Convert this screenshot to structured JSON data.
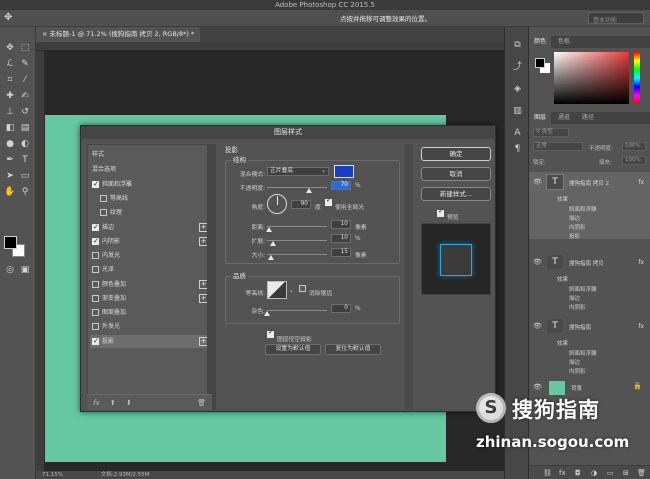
{
  "app": {
    "title": "Adobe Photoshop CC 2015.5"
  },
  "options_bar": {
    "hint": "点按并拖移可调整效果的位置。",
    "workspace": "基本功能",
    "move_icon": "move-icon"
  },
  "document": {
    "tab_label": "未标题-1 @ 71.2% (搜狗指南 拷贝 2, RGB/8*) *",
    "canvas_color": "#65c8a3"
  },
  "status_bar": {
    "zoom": "71.15%",
    "doc_info": "文档:2.93M/2.55M"
  },
  "toolbar": {
    "icons": [
      "move-icon",
      "marquee-icon",
      "lasso-icon",
      "quick-select-icon",
      "crop-icon",
      "eyedropper-icon",
      "heal-icon",
      "brush-icon",
      "stamp-icon",
      "history-brush-icon",
      "eraser-icon",
      "gradient-icon",
      "blur-icon",
      "dodge-icon",
      "pen-icon",
      "type-icon",
      "path-select-icon",
      "rectangle-icon",
      "hand-icon",
      "zoom-icon"
    ]
  },
  "right_panel": {
    "color_tabs": [
      "颜色",
      "色板"
    ],
    "layer_tabs": [
      "图层",
      "通道",
      "路径"
    ],
    "filter_label": "类型",
    "blend_mode": "正常",
    "opacity_label": "不透明度:",
    "opacity_value": "100%",
    "lock_label": "锁定:",
    "fill_label": "填充:",
    "fill_value": "100%",
    "layers": [
      {
        "name": "搜狗指南 拷贝 2",
        "effects_label": "效果",
        "effects": [
          "斜面和浮雕",
          "描边",
          "内阴影",
          "投影"
        ]
      },
      {
        "name": "搜狗指南 拷贝",
        "effects_label": "效果",
        "effects": [
          "斜面和浮雕",
          "描边",
          "内阴影"
        ]
      },
      {
        "name": "搜狗指南",
        "effects_label": "效果",
        "effects": [
          "斜面和浮雕",
          "描边",
          "内阴影"
        ]
      },
      {
        "name": "背景",
        "color": "#65c8a3"
      }
    ]
  },
  "dialog": {
    "title": "图层样式",
    "styles_header": "样式",
    "blend_options": "混合选项",
    "styles": [
      {
        "label": "斜面和浮雕",
        "checked": true,
        "plus": false
      },
      {
        "label": "等高线",
        "checked": false,
        "plus": false
      },
      {
        "label": "纹理",
        "checked": false,
        "plus": false
      },
      {
        "label": "描边",
        "checked": true,
        "plus": true
      },
      {
        "label": "内阴影",
        "checked": true,
        "plus": true
      },
      {
        "label": "内发光",
        "checked": false,
        "plus": false
      },
      {
        "label": "光泽",
        "checked": false,
        "plus": false
      },
      {
        "label": "颜色叠加",
        "checked": false,
        "plus": true
      },
      {
        "label": "渐变叠加",
        "checked": false,
        "plus": true
      },
      {
        "label": "图案叠加",
        "checked": false,
        "plus": false
      },
      {
        "label": "外发光",
        "checked": false,
        "plus": false
      },
      {
        "label": "投影",
        "checked": true,
        "plus": true,
        "selected": true
      }
    ],
    "fx_label": "fx",
    "section_title": "投影",
    "structure": {
      "title": "结构",
      "blend_label": "混合模式:",
      "blend_value": "正片叠底",
      "shadow_color": "#1b3fc4",
      "opacity_label": "不透明度:",
      "opacity_value": "70",
      "angle_label": "角度:",
      "angle_value": "90",
      "angle_unit": "度",
      "global_light": "使用全局光",
      "distance_label": "距离:",
      "distance_value": "10",
      "spread_label": "扩展:",
      "spread_value": "10",
      "size_label": "大小:",
      "size_value": "15",
      "px_unit": "像素",
      "pct_unit": "%",
      "opacity_level": 0.7,
      "distance_level": 0.04,
      "spread_level": 0.1,
      "size_level": 0.06
    },
    "quality": {
      "title": "品质",
      "contour_label": "等高线:",
      "antialias": "消除锯齿",
      "noise_label": "杂色:",
      "noise_value": "0",
      "noise_level": 0.0
    },
    "knockout": "图层挖空投影",
    "set_default": "设置为默认值",
    "reset_default": "复位为默认值",
    "buttons": {
      "ok": "确定",
      "cancel": "取消",
      "new_style": "新建样式...",
      "preview": "预览"
    }
  },
  "watermark": {
    "logo": "S",
    "name": "搜狗指南",
    "url": "zhinan.sogou.com"
  }
}
